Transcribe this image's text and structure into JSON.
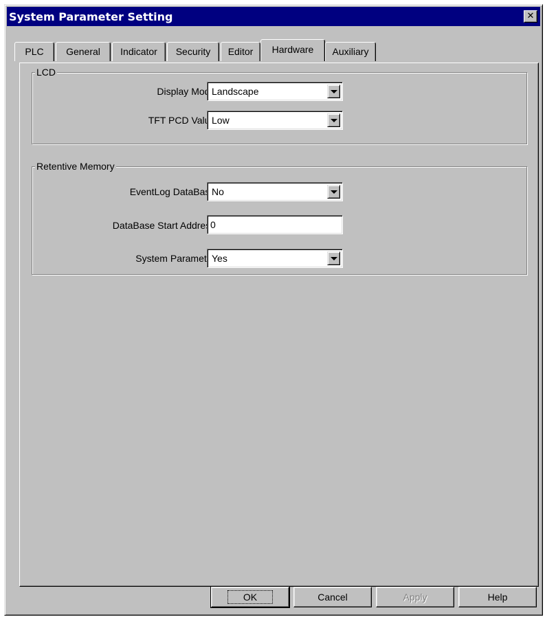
{
  "window": {
    "title": "System Parameter Setting",
    "close_glyph": "✕",
    "close_icon": "close-icon"
  },
  "tabs": [
    {
      "label": "PLC",
      "active": false
    },
    {
      "label": "General",
      "active": false
    },
    {
      "label": "Indicator",
      "active": false
    },
    {
      "label": "Security",
      "active": false
    },
    {
      "label": "Editor",
      "active": false
    },
    {
      "label": "Hardware",
      "active": true
    },
    {
      "label": "Auxiliary",
      "active": false
    }
  ],
  "lcd_group": {
    "title": "LCD",
    "display_mode": {
      "label": "Display Mode :",
      "value": "Landscape"
    },
    "tft_pcd_value": {
      "label": "TFT PCD Value :",
      "value": "Low"
    }
  },
  "retentive_group": {
    "title": "Retentive Memory",
    "eventlog_database": {
      "label": "EventLog DataBase :",
      "value": "No"
    },
    "database_start_address": {
      "label": "DataBase Start Address :",
      "value": "0"
    },
    "system_parameter": {
      "label": "System Parameter :",
      "value": "Yes"
    }
  },
  "buttons": {
    "ok": "OK",
    "cancel": "Cancel",
    "apply": "Apply",
    "help": "Help"
  },
  "colors": {
    "face": "#c0c0c0",
    "titlebar": "#000080",
    "title_text": "#ffffff",
    "disabled_text": "#808080"
  }
}
